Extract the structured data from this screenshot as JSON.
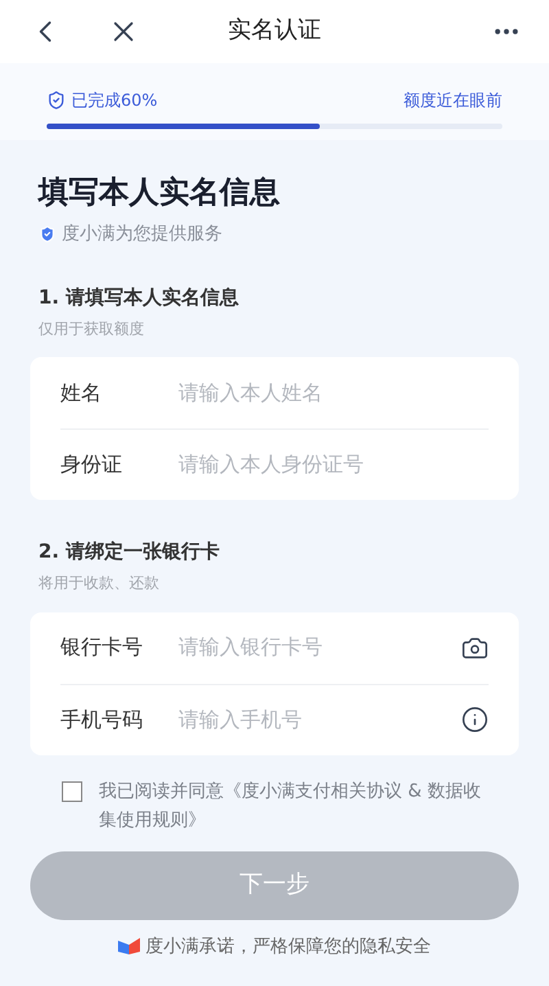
{
  "header": {
    "title": "实名认证"
  },
  "progress": {
    "label": "已完成60%",
    "level": 0.6,
    "hint": "额度近在眼前"
  },
  "heading": "填写本人实名信息",
  "provider": "度小满为您提供服务",
  "sections": [
    {
      "title": "1. 请填写本人实名信息",
      "note": "仅用于获取额度",
      "fields": [
        {
          "label": "姓名",
          "placeholder": "请输入本人姓名"
        },
        {
          "label": "身份证",
          "placeholder": "请输入本人身份证号"
        }
      ]
    },
    {
      "title": "2. 请绑定一张银行卡",
      "note": "将用于收款、还款",
      "fields": [
        {
          "label": "银行卡号",
          "placeholder": "请输入银行卡号",
          "kind": "camera"
        },
        {
          "label": "手机号码",
          "placeholder": "请输入手机号",
          "kind": "info"
        }
      ]
    }
  ],
  "agreement": {
    "checked": false,
    "text": "我已阅读并同意《度小满支付相关协议 & 数据收集使用规则》"
  },
  "next_button": {
    "label": "下一步",
    "disabled": true
  },
  "footer": "度小满承诺，严格保障您的隐私安全"
}
